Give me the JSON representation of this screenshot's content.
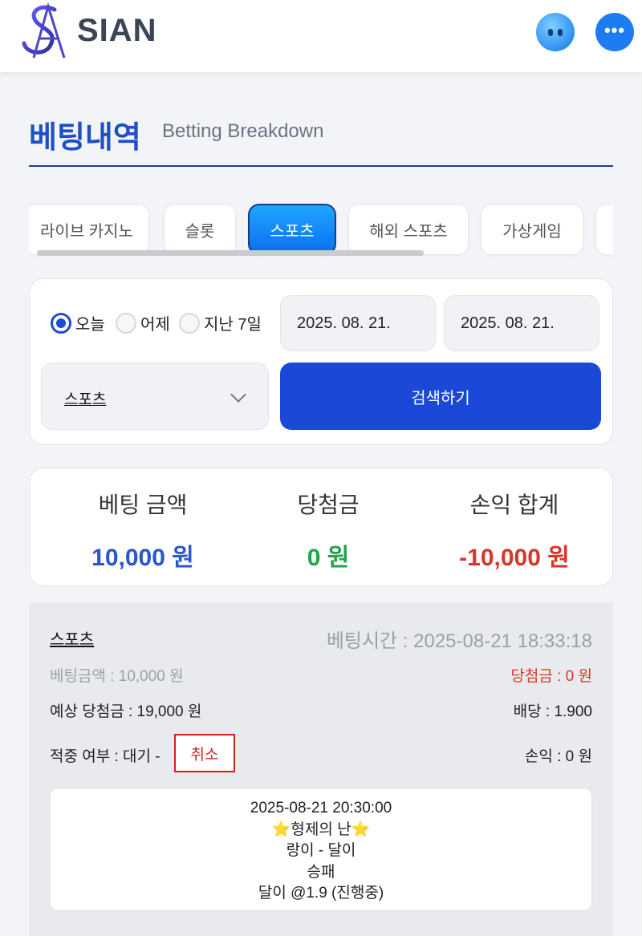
{
  "header": {
    "logo_text": "SIAN",
    "robot_icon": "robot-support-icon",
    "chat_icon": "chat-bubble-icon"
  },
  "page": {
    "title": "베팅내역",
    "subtitle": "Betting Breakdown"
  },
  "tabs": [
    {
      "label": "라이브 카지노",
      "active": false
    },
    {
      "label": "슬롯",
      "active": false
    },
    {
      "label": "스포츠",
      "active": true
    },
    {
      "label": "해외 스포츠",
      "active": false
    },
    {
      "label": "가상게임",
      "active": false
    },
    {
      "label": "",
      "active": false
    }
  ],
  "filter": {
    "radios": [
      {
        "label": "오늘",
        "checked": true
      },
      {
        "label": "어제",
        "checked": false
      },
      {
        "label": "지난 7일",
        "checked": false
      }
    ],
    "date_from": "2025. 08. 21.",
    "date_to": "2025. 08. 21.",
    "category_selected": "스포츠",
    "search_label": "검색하기"
  },
  "summary": {
    "bet_amount_label": "베팅 금액",
    "bet_amount_value": "10,000 원",
    "winnings_label": "당첨금",
    "winnings_value": "0 원",
    "profit_label": "손익 합계",
    "profit_value": "-10,000 원"
  },
  "bet": {
    "type": "스포츠",
    "bet_time": "베팅시간 : 2025-08-21 18:33:18",
    "bet_amount": "베팅금액 : 10,000 원",
    "winnings": "당첨금 : 0 원",
    "expected_winnings": "예상 당첨금 : 19,000 원",
    "odds": "배당 : 1.900",
    "result_status": "적중 여부 : 대기 -",
    "cancel_label": "취소",
    "profit": "손익 : 0 원",
    "match": {
      "datetime": "2025-08-21 20:30:00",
      "league": "⭐형제의 난⭐",
      "teams": "랑이 - 달이",
      "market": "승패",
      "pick": "달이 @1.9 (진행중)"
    }
  },
  "colors": {
    "primary": "#1b48d6",
    "bet_amount": "#2a57c9",
    "winnings": "#22a34a",
    "loss": "#d9362b",
    "cancel": "#d11f1f"
  }
}
